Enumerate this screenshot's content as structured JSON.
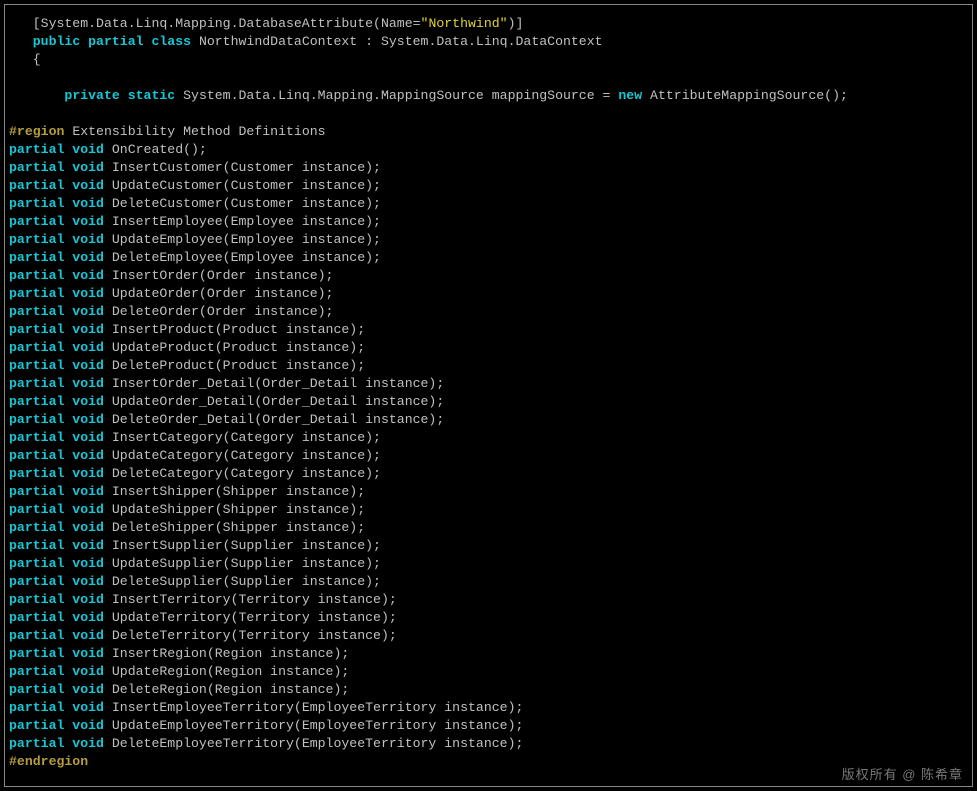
{
  "attr_open": "   [System.Data.Linq.Mapping.DatabaseAttribute(Name=",
  "attr_str": "\"Northwind\"",
  "attr_close": ")]",
  "cls_pre": "   ",
  "cls_kw": "public partial class",
  "cls_rest": " NorthwindDataContext : System.Data.Linq.DataContext",
  "brace_open": "   {",
  "fld_pre": "       ",
  "fld_kw1": "private static",
  "fld_mid": " System.Data.Linq.Mapping.MappingSource mappingSource = ",
  "fld_kw2": "new",
  "fld_end": " AttributeMappingSource();",
  "region_kw": "#region",
  "region_rest": " Extensibility Method Definitions",
  "endregion": "#endregion",
  "pv": "partial void",
  "methods": [
    " OnCreated();",
    " InsertCustomer(Customer instance);",
    " UpdateCustomer(Customer instance);",
    " DeleteCustomer(Customer instance);",
    " InsertEmployee(Employee instance);",
    " UpdateEmployee(Employee instance);",
    " DeleteEmployee(Employee instance);",
    " InsertOrder(Order instance);",
    " UpdateOrder(Order instance);",
    " DeleteOrder(Order instance);",
    " InsertProduct(Product instance);",
    " UpdateProduct(Product instance);",
    " DeleteProduct(Product instance);",
    " InsertOrder_Detail(Order_Detail instance);",
    " UpdateOrder_Detail(Order_Detail instance);",
    " DeleteOrder_Detail(Order_Detail instance);",
    " InsertCategory(Category instance);",
    " UpdateCategory(Category instance);",
    " DeleteCategory(Category instance);",
    " InsertShipper(Shipper instance);",
    " UpdateShipper(Shipper instance);",
    " DeleteShipper(Shipper instance);",
    " InsertSupplier(Supplier instance);",
    " UpdateSupplier(Supplier instance);",
    " DeleteSupplier(Supplier instance);",
    " InsertTerritory(Territory instance);",
    " UpdateTerritory(Territory instance);",
    " DeleteTerritory(Territory instance);",
    " InsertRegion(Region instance);",
    " UpdateRegion(Region instance);",
    " DeleteRegion(Region instance);",
    " InsertEmployeeTerritory(EmployeeTerritory instance);",
    " UpdateEmployeeTerritory(EmployeeTerritory instance);",
    " DeleteEmployeeTerritory(EmployeeTerritory instance);"
  ],
  "watermark": "版权所有 @ 陈希章"
}
